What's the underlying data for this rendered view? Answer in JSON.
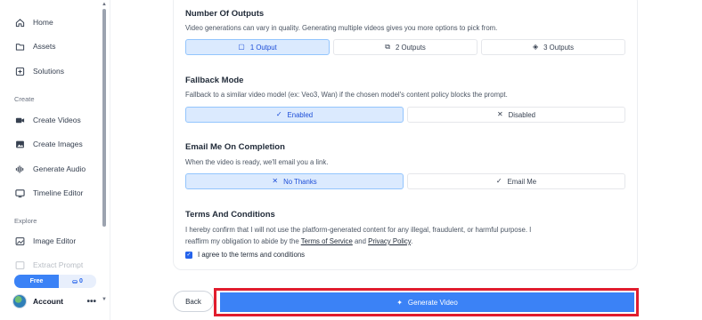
{
  "sidebar": {
    "items": [
      {
        "label": "Home",
        "icon": "home-icon"
      },
      {
        "label": "Assets",
        "icon": "folder-icon"
      },
      {
        "label": "Solutions",
        "icon": "plus-square-icon"
      }
    ],
    "create_label": "Create",
    "create_items": [
      {
        "label": "Create Videos",
        "icon": "video-camera-icon"
      },
      {
        "label": "Create Images",
        "icon": "image-icon"
      },
      {
        "label": "Generate Audio",
        "icon": "audio-wave-icon"
      },
      {
        "label": "Timeline Editor",
        "icon": "monitor-icon"
      }
    ],
    "explore_label": "Explore",
    "explore_items": [
      {
        "label": "Image Editor",
        "icon": "image-editor-icon"
      },
      {
        "label": "Extract Prompt",
        "icon": "extract-icon"
      }
    ],
    "plan": {
      "name": "Free",
      "credits": "0"
    },
    "account": {
      "label": "Account",
      "more": "•••"
    }
  },
  "outputs": {
    "title": "Number Of Outputs",
    "description": "Video generations can vary in quality. Generating multiple videos gives you more options to pick from.",
    "options": [
      "1 Output",
      "2 Outputs",
      "3 Outputs"
    ],
    "selected": "1 Output"
  },
  "fallback": {
    "title": "Fallback Mode",
    "description": "Fallback to a similar video model (ex: Veo3, Wan) if the chosen model's content policy blocks the prompt.",
    "options": [
      "Enabled",
      "Disabled"
    ],
    "selected": "Enabled"
  },
  "email": {
    "title": "Email Me On Completion",
    "description": "When the video is ready, we'll email you a link.",
    "options": [
      "No Thanks",
      "Email Me"
    ],
    "selected": "No Thanks"
  },
  "terms": {
    "title": "Terms And Conditions",
    "text_before": "I hereby confirm that I will not use the platform-generated content for any illegal, fraudulent, or harmful purpose. I reaffirm my obligation to abide by the ",
    "tos_link": "Terms of Service",
    "and": " and ",
    "privacy_link": "Privacy Policy",
    "text_after": ".",
    "agree_label": "I agree to the terms and conditions",
    "agreed": true
  },
  "footer": {
    "back_label": "Back",
    "generate_label": "Generate Video"
  },
  "colors": {
    "accent": "#3b82f6",
    "selected_bg": "#dbeafe",
    "highlight_outline": "#e11d2e"
  }
}
